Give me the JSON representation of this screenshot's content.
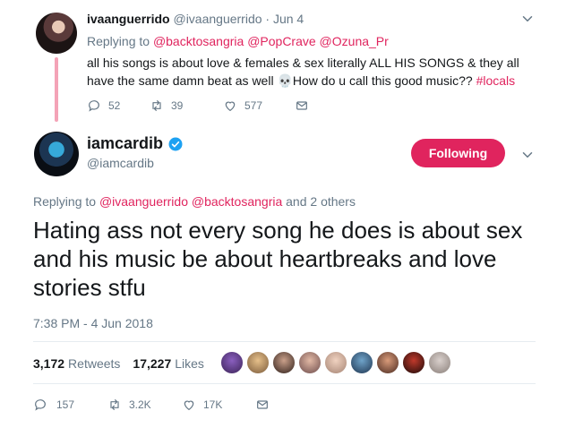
{
  "parent_tweet": {
    "display_name": "ivaanguerrido",
    "handle": "@ivaanguerrido",
    "date": "· Jun 4",
    "replying_prefix": "Replying to ",
    "replying_to": "@backtosangria @PopCrave @Ozuna_Pr",
    "text_main": "all his songs is about love & females & sex literally ALL HIS SONGS & they all have the same damn beat as well ",
    "emoji": "💀",
    "text_after_emoji": "How do u call this good music?? ",
    "hashtag": "#locals",
    "replies": "52",
    "retweets": "39",
    "likes": "577"
  },
  "main_tweet": {
    "display_name": "iamcardib",
    "handle": "@iamcardib",
    "follow_label": "Following",
    "replying_prefix": "Replying to ",
    "replying_to": "@ivaanguerrido @backtosangria",
    "replying_suffix": " and 2 others",
    "text": "Hating ass not every song he does is about sex and his music be about heartbreaks and love stories stfu",
    "timestamp": "7:38 PM - 4 Jun 2018",
    "retweet_count": "3,172",
    "retweet_label": "Retweets",
    "like_count": "17,227",
    "like_label": "Likes",
    "replies": "157",
    "retweets": "3.2K",
    "likes": "17K"
  },
  "colors": {
    "accent": "#e0245e",
    "thread_line": "#f4a3b7",
    "verified": "#1da1f2",
    "secondary_text": "#657786"
  }
}
